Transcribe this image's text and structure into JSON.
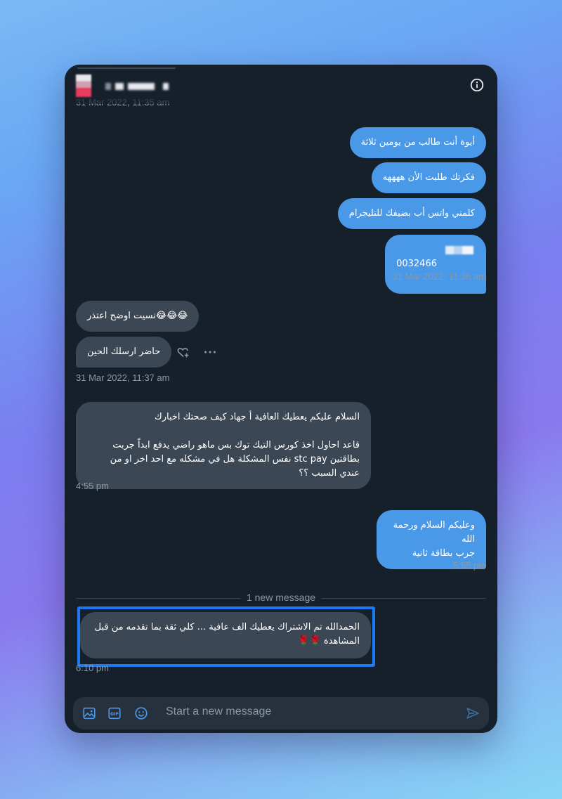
{
  "header": {
    "cut_timestamp": "31 Mar 2022, 11:35 am",
    "info_icon": "info-icon"
  },
  "messages": [
    {
      "dir": "out",
      "text": "أيوة أنت طالب من يومين ثلاثة"
    },
    {
      "dir": "out",
      "text": "فكرتك طلبت الأن ههههه"
    },
    {
      "dir": "out",
      "text": "كلمني واتس أب بضيفك للتليجرام"
    },
    {
      "dir": "out",
      "text": "0032466"
    },
    {
      "dir": "out",
      "time": "31 Mar 2022, 11:36 am"
    },
    {
      "dir": "in",
      "text": "😂😂😂نسيت اوضح اعتذر"
    },
    {
      "dir": "in",
      "text": "حاضر ارسلك الحين"
    },
    {
      "dir": "in",
      "time": "31 Mar 2022, 11:37 am"
    },
    {
      "dir": "in",
      "text": "السلام عليكم يعطيك العافية أ جهاد كيف صحتك اخبارك\n\nقاعد احاول اخذ كورس التيك توك بس ماهو راضي يدفع ابداً جربت بطاقتين stc pay نفس المشكلة هل في مشكله مع احد اخر او من عندي السبب ؟؟"
    },
    {
      "dir": "in",
      "time": "4:55 pm"
    },
    {
      "dir": "out",
      "text": "وعليكم السلام ورحمة الله\nجرب بطاقة ثانية"
    },
    {
      "dir": "out",
      "time": "5:55 pm"
    },
    {
      "dir": "in",
      "text": "الحمدالله تم الاشتراك يعطيك الف عافية ... كلي ثقة بما تقدمه من قبل المشاهدة 🌹🌹"
    },
    {
      "dir": "in",
      "time": "6:10 pm"
    }
  ],
  "divider": {
    "label": "1 new message"
  },
  "composer": {
    "placeholder": "Start a new message",
    "icons": [
      "image-icon",
      "gif-icon",
      "emoji-icon",
      "send-icon"
    ]
  },
  "reaction_icons": [
    "heart-plus-icon",
    "more-icon"
  ],
  "colors": {
    "background": "#15202b",
    "outgoing_bubble": "#4a99e9",
    "incoming_bubble": "#3b4754",
    "highlight": "#1d78f5",
    "muted_text": "#8b98a5"
  }
}
